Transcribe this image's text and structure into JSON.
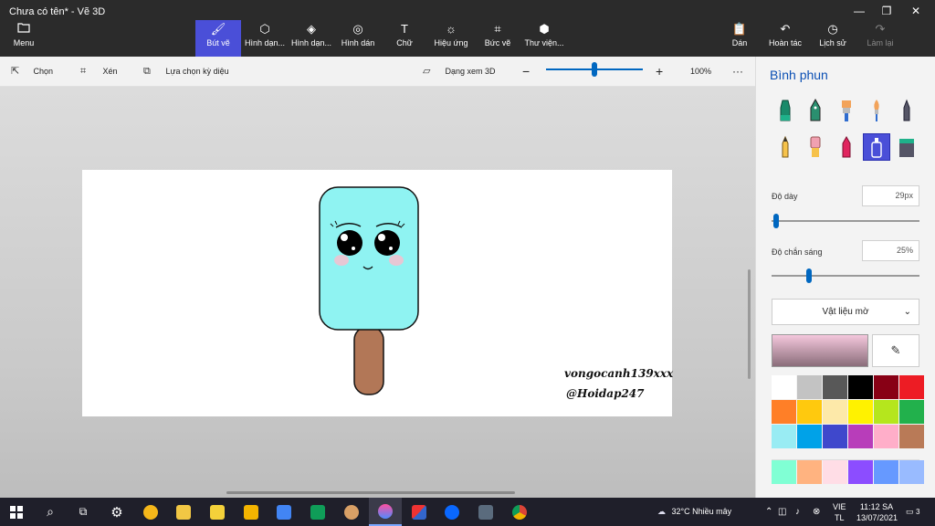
{
  "window": {
    "title": "Chưa có tên* - Vẽ 3D",
    "controls": [
      "—",
      "❐",
      "✕"
    ]
  },
  "ribbon": {
    "menu": "Menu",
    "tools": [
      {
        "label": "Bút vẽ",
        "icon": "brush-icon"
      },
      {
        "label": "Hình dạn...",
        "icon": "shapes2d-icon"
      },
      {
        "label": "Hình dạn...",
        "icon": "cube-icon"
      },
      {
        "label": "Hình dán",
        "icon": "sticker-icon"
      },
      {
        "label": "Chữ",
        "icon": "text-icon"
      },
      {
        "label": "Hiệu ứng",
        "icon": "effects-icon"
      },
      {
        "label": "Bức vẽ",
        "icon": "canvas-icon"
      },
      {
        "label": "Thư viện...",
        "icon": "library-icon"
      }
    ],
    "right": [
      {
        "label": "Dán",
        "icon": "paste-icon"
      },
      {
        "label": "Hoàn tác",
        "icon": "undo-icon"
      },
      {
        "label": "Lịch sử",
        "icon": "history-icon"
      },
      {
        "label": "Làm lại",
        "icon": "redo-icon"
      }
    ]
  },
  "toolbar": {
    "select": "Chọn",
    "crop": "Xén",
    "magic_select": "Lựa chọn kỳ diệu",
    "view_3d": "Dạng xem 3D",
    "zoom": "100%",
    "zoom_level": 0.5,
    "more": "···"
  },
  "canvas": {
    "signature_line1": "vongocanh139xxx",
    "signature_line2": "@Hoidap247"
  },
  "panel": {
    "title": "Bình phun",
    "brushes": [
      "marker-icon",
      "calligraphy-pen-icon",
      "oil-brush-icon",
      "watercolor-icon",
      "pixel-pen-icon",
      "pencil-icon",
      "eraser-icon",
      "crayon-icon",
      "spray-can-icon",
      "fill-icon"
    ],
    "thickness_label": "Độ dày",
    "thickness_value": "29px",
    "thickness_level": 0.03,
    "opacity_label": "Độ chắn sáng",
    "opacity_value": "25%",
    "opacity_level": 0.25,
    "material": "Vật liệu mờ",
    "colors_row1": [
      "#ffffff",
      "#c3c3c3",
      "#585858",
      "#000000",
      "#880015",
      "#ed1c24",
      "#ff7f27",
      "#ffc90e",
      "#fde9a9",
      "#fff200",
      "#b5e61d",
      "#22b14c",
      "#99ecf3",
      "#00a2e8",
      "#3f48cc",
      "#b83dba",
      "#ffaec9",
      "#b97a57"
    ],
    "colors_row2": [
      "#80ffd4",
      "#ffb380",
      "#ffdde6",
      "#8c4dff",
      "#6699ff",
      "#99bbff"
    ]
  },
  "taskbar": {
    "weather": "32°C  Nhiều mây",
    "lang1": "VIE",
    "lang2": "TL",
    "time": "11:12 SA",
    "date": "13/07/2021",
    "notif": "3"
  }
}
